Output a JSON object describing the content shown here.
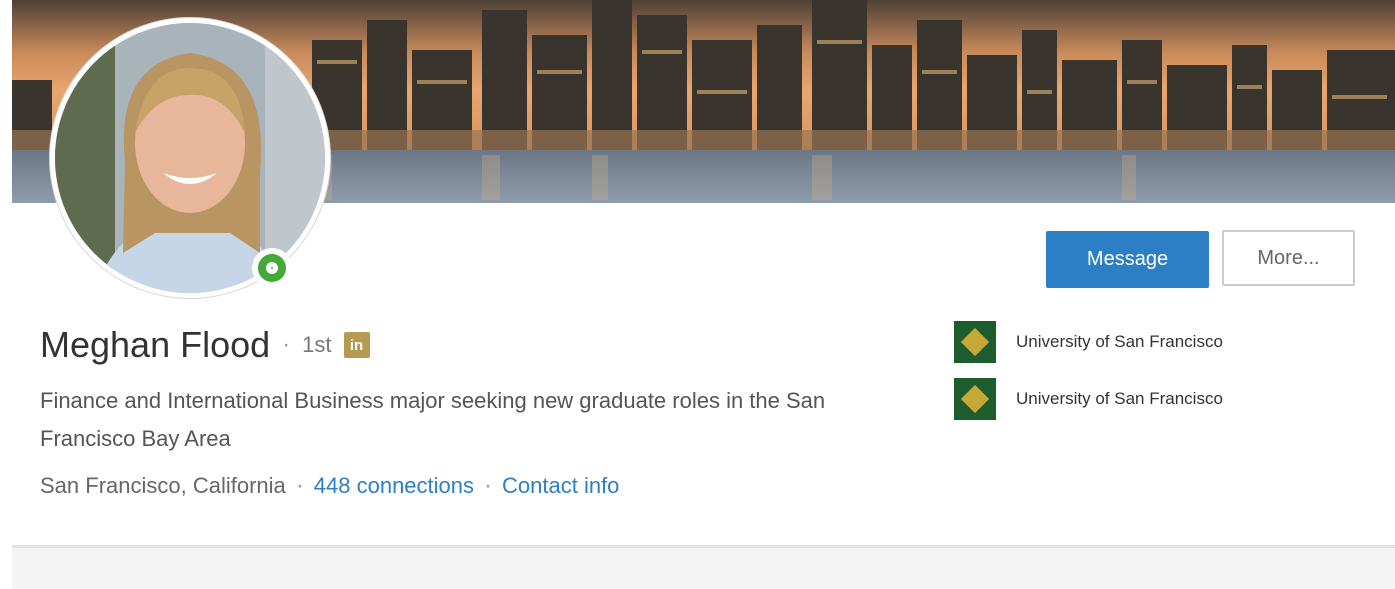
{
  "profile": {
    "name": "Meghan Flood",
    "separator": "·",
    "degree": "1st",
    "linkedin_badge": "in",
    "headline": "Finance and International Business major seeking new graduate roles in the San Francisco Bay Area",
    "location": "San Francisco, California",
    "connections": "448 connections",
    "contact_info": "Contact info"
  },
  "actions": {
    "message_label": "Message",
    "more_label": "More..."
  },
  "education": [
    {
      "school": "University of San Francisco"
    },
    {
      "school": "University of San Francisco"
    }
  ],
  "colors": {
    "primary_button": "#2d7fc5",
    "link": "#2d7fc5",
    "online": "#44a937",
    "badge": "#b79a52",
    "school_logo": "#1d5c2c"
  },
  "icons": {
    "linkedin": "linkedin-icon",
    "online_status": "online-status-icon",
    "school_logo": "school-logo-icon"
  }
}
